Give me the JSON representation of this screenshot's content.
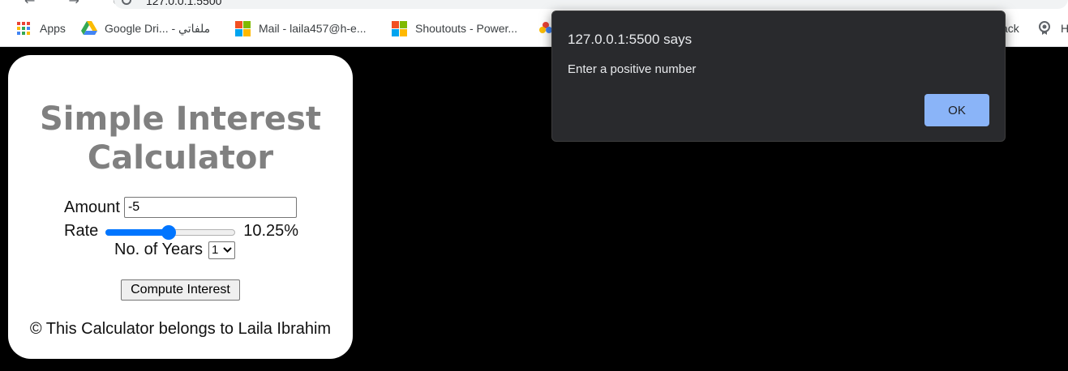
{
  "browser": {
    "url": "127.0.0.1:5500",
    "nav_glyphs": "← → C",
    "bookmarks": [
      {
        "label": "Apps"
      },
      {
        "label": "Google Dri... - ملفاتي"
      },
      {
        "label": "Mail - laila457@h-e..."
      },
      {
        "label": "Shoutouts - Power..."
      },
      {
        "label": "ack"
      },
      {
        "label": "H"
      }
    ]
  },
  "page": {
    "title_line1": "Simple Interest",
    "title_line2": "Calculator",
    "amount_label": "Amount",
    "amount_value": "-5",
    "rate_label": "Rate",
    "rate_value": 10.25,
    "rate_min": 1,
    "rate_max": 20,
    "rate_display": "10.25%",
    "years_label": "No. of Years",
    "years_value": "1",
    "compute_label": "Compute Interest",
    "footer": "© This Calculator belongs to Laila Ibrahim"
  },
  "dialog": {
    "title": "127.0.0.1:5500 says",
    "message": "Enter a positive number",
    "ok_label": "OK"
  },
  "colors": {
    "accent": "#0075ff",
    "dialog_bg": "#292a2d",
    "ok_button": "#8ab4f8",
    "title_gray": "#808080"
  }
}
